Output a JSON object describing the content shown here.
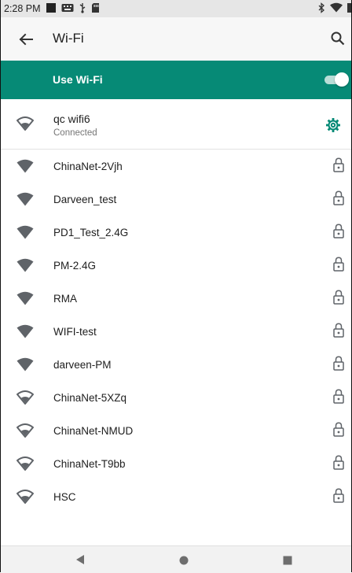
{
  "status_bar": {
    "time": "2:28 PM",
    "left_icons": [
      "notification-square-icon",
      "keyboard-icon",
      "usb-icon",
      "sd-card-icon"
    ],
    "right_icons": [
      "bluetooth-icon",
      "wifi-signal-icon",
      "battery-icon"
    ]
  },
  "app_bar": {
    "title": "Wi-Fi",
    "back_icon": "arrow-left-icon",
    "search_icon": "search-icon"
  },
  "master_switch": {
    "label": "Use Wi-Fi",
    "enabled": true
  },
  "connected_network": {
    "name": "qc wifi6",
    "status": "Connected",
    "signal": "outline",
    "settings_icon": "gear-icon"
  },
  "networks": [
    {
      "name": "ChinaNet-2Vjh",
      "signal": "full",
      "secured": true
    },
    {
      "name": "Darveen_test",
      "signal": "full",
      "secured": true
    },
    {
      "name": "PD1_Test_2.4G",
      "signal": "full",
      "secured": true
    },
    {
      "name": "PM-2.4G",
      "signal": "full",
      "secured": true
    },
    {
      "name": "RMA",
      "signal": "full",
      "secured": true
    },
    {
      "name": "WIFI-test",
      "signal": "full",
      "secured": true
    },
    {
      "name": "darveen-PM",
      "signal": "full",
      "secured": true
    },
    {
      "name": "ChinaNet-5XZq",
      "signal": "outline",
      "secured": true
    },
    {
      "name": "ChinaNet-NMUD",
      "signal": "outline",
      "secured": true
    },
    {
      "name": "ChinaNet-T9bb",
      "signal": "outline",
      "secured": true
    },
    {
      "name": "HSC",
      "signal": "outline",
      "secured": true
    }
  ],
  "nav_bar": {
    "icons": [
      "nav-back-icon",
      "nav-home-icon",
      "nav-recents-icon"
    ]
  },
  "colors": {
    "accent": "#068a76",
    "icon_gray": "#5f6368",
    "text_primary": "#202020",
    "text_secondary": "#757575"
  }
}
